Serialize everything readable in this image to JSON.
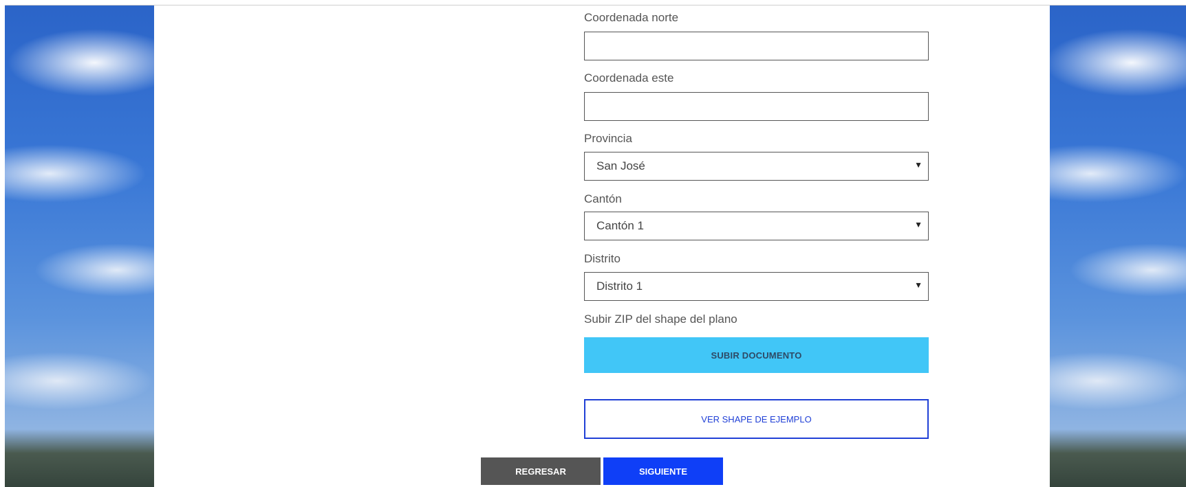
{
  "form": {
    "north": {
      "label": "Coordenada norte",
      "value": ""
    },
    "east": {
      "label": "Coordenada este",
      "value": ""
    },
    "provincia": {
      "label": "Provincia",
      "selected": "San José"
    },
    "canton": {
      "label": "Cantón",
      "selected": "Cantón 1"
    },
    "distrito": {
      "label": "Distrito",
      "selected": "Distrito 1"
    },
    "upload": {
      "label": "Subir ZIP del shape del plano",
      "button": "SUBIR DOCUMENTO"
    },
    "example_button": "VER SHAPE DE EJEMPLO"
  },
  "nav": {
    "back": "REGRESAR",
    "next": "SIGUIENTE"
  },
  "colors": {
    "upload_button": "#41c6f7",
    "example_border": "#1f3fd6",
    "back_button": "#555555",
    "next_button": "#0f3ff7"
  }
}
